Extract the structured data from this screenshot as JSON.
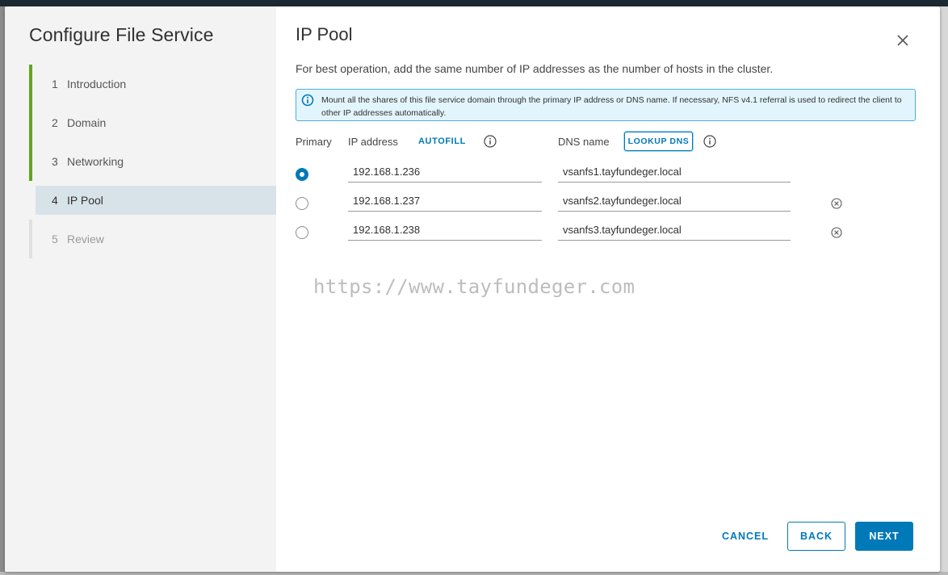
{
  "wizard": {
    "title": "Configure File Service",
    "steps": [
      {
        "num": "1",
        "label": "Introduction"
      },
      {
        "num": "2",
        "label": "Domain"
      },
      {
        "num": "3",
        "label": "Networking"
      },
      {
        "num": "4",
        "label": "IP Pool"
      },
      {
        "num": "5",
        "label": "Review"
      }
    ]
  },
  "page": {
    "title": "IP Pool",
    "intro": "For best operation, add the same number of IP addresses as the number of hosts in the cluster.",
    "info": "Mount all the shares of this file service domain through the primary IP address or DNS name. If necessary, NFS v4.1 referral is used to redirect the client to other IP addresses automatically."
  },
  "table": {
    "headers": {
      "primary": "Primary",
      "ip": "IP address",
      "dns": "DNS name"
    },
    "autofill_label": "AUTOFILL",
    "lookup_label": "LOOKUP DNS",
    "rows": [
      {
        "ip": "192.168.1.236",
        "dns": "vsanfs1.tayfundeger.local",
        "primary": true
      },
      {
        "ip": "192.168.1.237",
        "dns": "vsanfs2.tayfundeger.local",
        "primary": false
      },
      {
        "ip": "192.168.1.238",
        "dns": "vsanfs3.tayfundeger.local",
        "primary": false
      }
    ]
  },
  "watermark": "https://www.tayfundeger.com",
  "footer": {
    "cancel": "CANCEL",
    "back": "BACK",
    "next": "NEXT"
  },
  "colors": {
    "accent": "#0079b8",
    "step_done": "#62a420",
    "active_step_bg": "#d8e3e9",
    "info_bg": "#e3f5fc"
  }
}
